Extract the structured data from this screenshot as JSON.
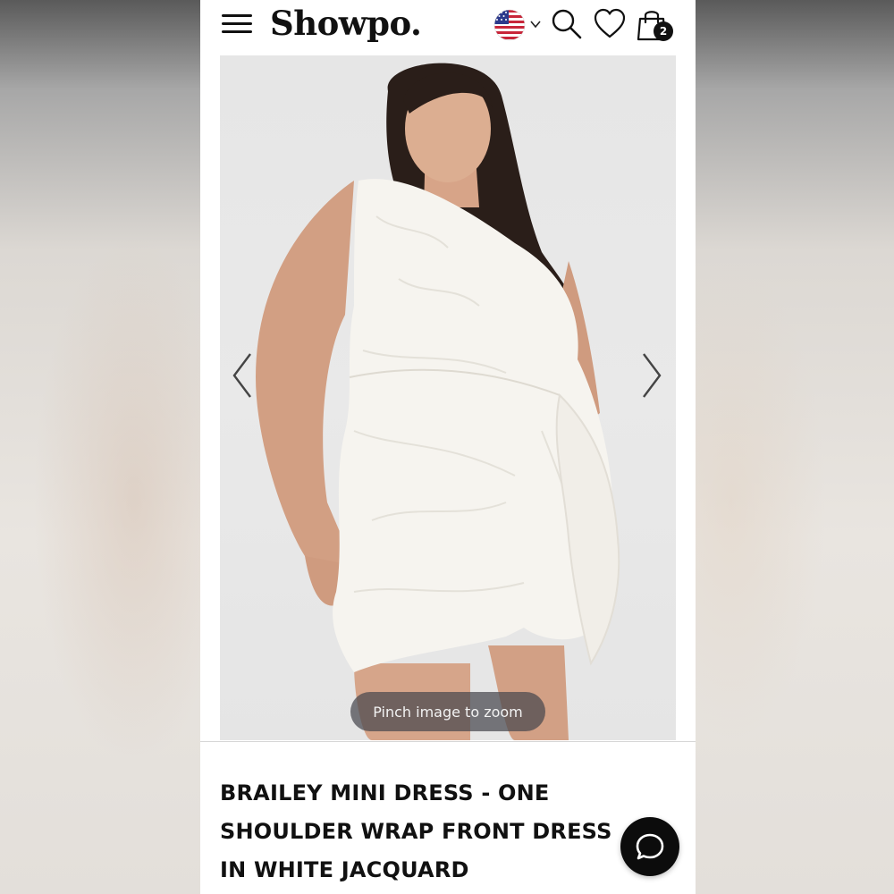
{
  "header": {
    "logo": "Showpo.",
    "cart_count": "2",
    "icons": [
      "menu-icon",
      "us-flag-icon",
      "chevron-down-icon",
      "search-icon",
      "heart-icon",
      "shopping-bag-icon"
    ]
  },
  "gallery": {
    "zoom_hint": "Pinch image to zoom",
    "icons": [
      "chevron-left-icon",
      "chevron-right-icon"
    ]
  },
  "product": {
    "title": "BRAILEY MINI DRESS - ONE SHOULDER WRAP FRONT DRESS IN WHITE JACQUARD"
  },
  "chat": {
    "icon": "chat-bubble-icon"
  },
  "colors": {
    "page_bg": "#ffffff",
    "text": "#111111",
    "gallery_bg": "#e7e7e7",
    "badge": "#111111",
    "chat_button": "#0c0c0c"
  }
}
